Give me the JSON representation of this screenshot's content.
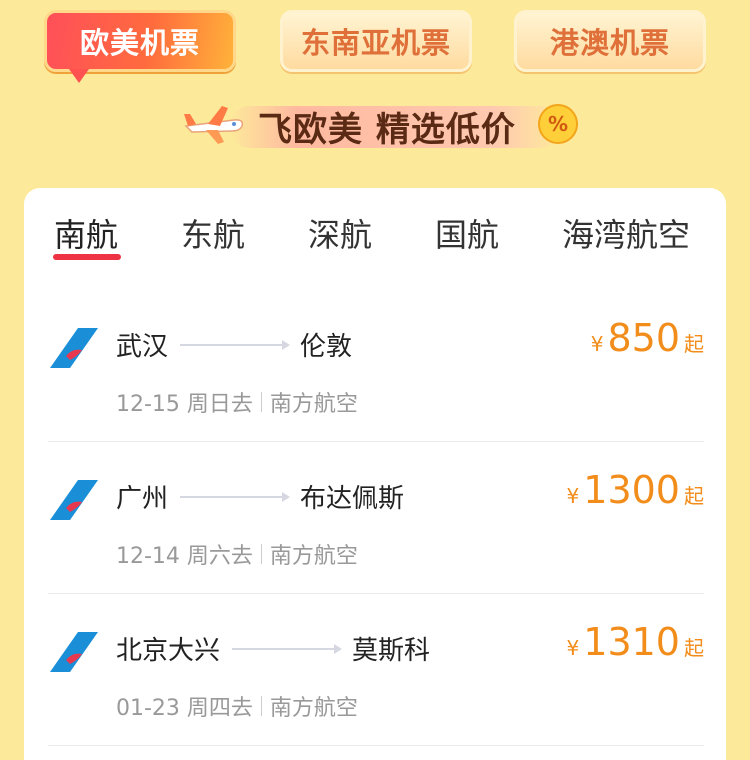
{
  "top_tabs": [
    {
      "label": "欧美机票"
    },
    {
      "label": "东南亚机票"
    },
    {
      "label": "港澳机票"
    }
  ],
  "banner": {
    "text": "飞欧美 精选低价",
    "badge": "%"
  },
  "airline_tabs": [
    {
      "label": "南航"
    },
    {
      "label": "东航"
    },
    {
      "label": "深航"
    },
    {
      "label": "国航"
    },
    {
      "label": "海湾航空"
    }
  ],
  "flights": [
    {
      "from": "武汉",
      "to": "伦敦",
      "date": "12-15 周日去",
      "airline": "南方航空",
      "currency": "¥",
      "price": "850",
      "suffix": "起"
    },
    {
      "from": "广州",
      "to": "布达佩斯",
      "date": "12-14 周六去",
      "airline": "南方航空",
      "currency": "¥",
      "price": "1300",
      "suffix": "起"
    },
    {
      "from": "北京大兴",
      "to": "莫斯科",
      "date": "01-23 周四去",
      "airline": "南方航空",
      "currency": "¥",
      "price": "1310",
      "suffix": "起"
    }
  ],
  "colors": {
    "accent": "#ee3344",
    "price": "#f28c1a",
    "background": "#fde99a"
  }
}
